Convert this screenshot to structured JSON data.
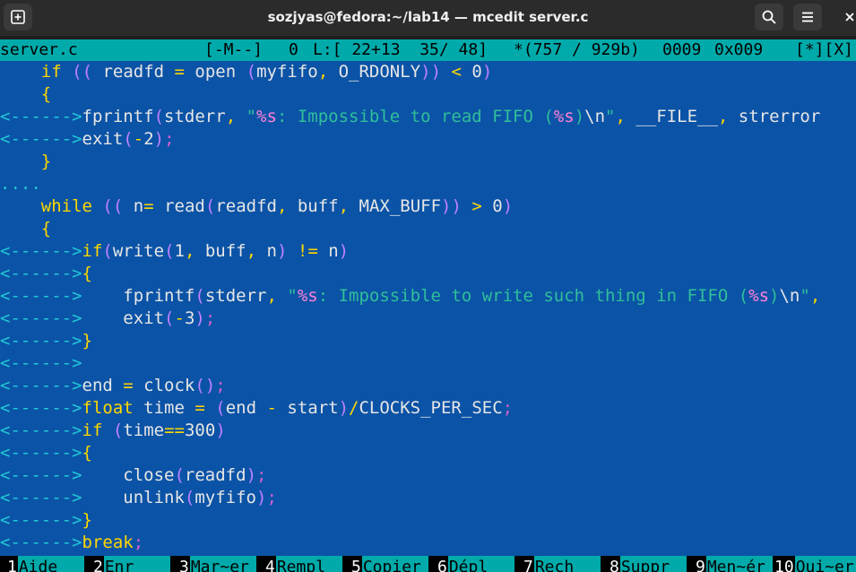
{
  "window": {
    "title": "sozjyas@fedora:~/lab14 — mcedit server.c"
  },
  "status": {
    "filename": "server.c",
    "mode": "[-M--]",
    "col": "0",
    "line_info": "L:[ 22+13  35/ 48]",
    "bytes": "*(757 / 929b)",
    "char_dec": "0009",
    "char_hex": "0x009",
    "buttons": "[*][X]"
  },
  "code_lines": [
    "    if (( readfd = open (myfifo, O_RDONLY)) < 0)",
    "    {",
    "<------>fprintf(stderr, \"%s: Impossible to read FIFO (%s)\\n\", __FILE__, strerror",
    "<------>exit(-2);",
    "    }",
    "....",
    "    while (( n= read(readfd, buff, MAX_BUFF)) > 0)",
    "    {",
    "<------>if(write(1, buff, n) != n)",
    "<------>{",
    "<------>    fprintf(stderr, \"%s: Impossible to write such thing in FIFO (%s)\\n\",",
    "<------>    exit(-3);",
    "<------>}",
    "<------>",
    "<------>end = clock();",
    "<------>float time = (end - start)/CLOCKS_PER_SEC;",
    "<------>if (time==300)",
    "<------>{",
    "<------>    close(readfd);",
    "<------>    unlink(myfifo);",
    "<------>}",
    "<------>break;"
  ],
  "fkeys": [
    {
      "num": "1",
      "label": "Aide"
    },
    {
      "num": "2",
      "label": "Enr"
    },
    {
      "num": "3",
      "label": "Mar~er"
    },
    {
      "num": "4",
      "label": "Rempl"
    },
    {
      "num": "5",
      "label": "Copier"
    },
    {
      "num": "6",
      "label": "Dépl"
    },
    {
      "num": "7",
      "label": "Rech"
    },
    {
      "num": "8",
      "label": "Suppr"
    },
    {
      "num": "9",
      "label": "Men~ér"
    },
    {
      "num": "10",
      "label": "Qui~er"
    }
  ],
  "icons": {
    "new_tab": "new-tab-icon",
    "search": "search-icon",
    "menu": "hamburger-menu-icon",
    "close": "close-icon"
  },
  "colors": {
    "editor_bg": "#0b53a6",
    "status_bg": "#00aaaa",
    "titlebar_bg": "#2b2b2b"
  }
}
